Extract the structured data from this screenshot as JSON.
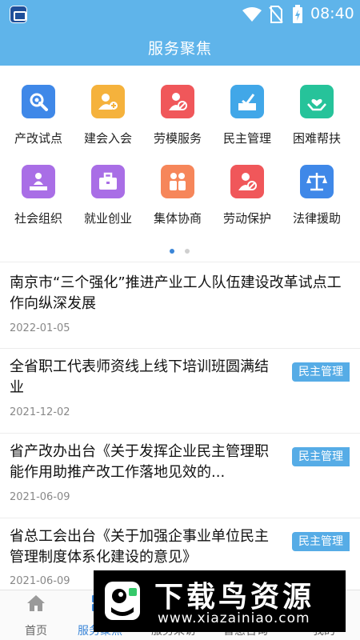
{
  "status_bar": {
    "time": "08:40",
    "icons": [
      "app-icon",
      "wifi-icon",
      "no-sim-icon",
      "battery-charging-icon"
    ]
  },
  "header": {
    "title": "服务聚焦"
  },
  "services": [
    {
      "label": "产改试点",
      "icon": "gear-wrench-icon",
      "color": "#3f88e8"
    },
    {
      "label": "建会入会",
      "icon": "add-member-icon",
      "color": "#f5b23c"
    },
    {
      "label": "劳模服务",
      "icon": "model-worker-icon",
      "color": "#f0575a"
    },
    {
      "label": "民主管理",
      "icon": "ballot-icon",
      "color": "#41a7e8"
    },
    {
      "label": "困难帮扶",
      "icon": "helping-hands-icon",
      "color": "#26c39a"
    },
    {
      "label": "社会组织",
      "icon": "organization-icon",
      "color": "#a96ee6"
    },
    {
      "label": "就业创业",
      "icon": "briefcase-icon",
      "color": "#a96ee6"
    },
    {
      "label": "集体协商",
      "icon": "group-discussion-icon",
      "color": "#f6865a"
    },
    {
      "label": "劳动保护",
      "icon": "protected-worker-icon",
      "color": "#f0575a"
    },
    {
      "label": "法律援助",
      "icon": "scales-icon",
      "color": "#3f88e8"
    }
  ],
  "pager": {
    "pages": 2,
    "current": 1
  },
  "news": [
    {
      "title": "南京市“三个强化”推进产业工人队伍建设改革试点工作向纵深发展",
      "date": "2022-01-05",
      "tag": ""
    },
    {
      "title": "全省职工代表师资线上线下培训班圆满结业",
      "date": "2021-12-02",
      "tag": "民主管理"
    },
    {
      "title": "省产改办出台《关于发挥企业民主管理职能作用助推产改工作落地见效的...",
      "date": "2021-06-09",
      "tag": "民主管理"
    },
    {
      "title": "省总工会出台《关于加强企事业单位民主管理制度体系化建设的意见》",
      "date": "2021-06-09",
      "tag": "民主管理"
    }
  ],
  "bottom_nav": [
    {
      "label": "首页",
      "icon": "home-icon",
      "active": false
    },
    {
      "label": "服务聚焦",
      "icon": "service-icon",
      "active": true
    },
    {
      "label": "服务采访",
      "icon": "interview-icon",
      "active": false
    },
    {
      "label": "普惠咨询",
      "icon": "consult-icon",
      "active": false
    },
    {
      "label": "我的",
      "icon": "profile-icon",
      "active": false
    }
  ],
  "watermark": {
    "name": "下载鸟资源",
    "url": "www.xiazainiao.com"
  }
}
